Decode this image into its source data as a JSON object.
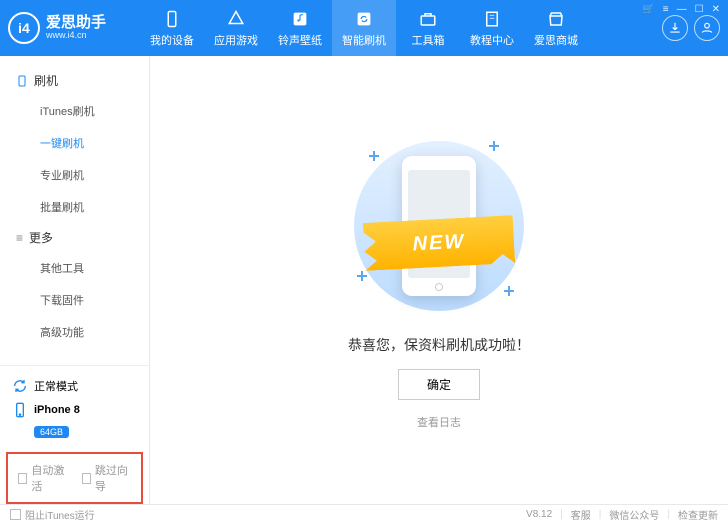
{
  "header": {
    "logo_title": "爱思助手",
    "logo_sub": "www.i4.cn",
    "logo_mark": "i4",
    "tabs": [
      {
        "label": "我的设备",
        "icon": "phone"
      },
      {
        "label": "应用游戏",
        "icon": "apps"
      },
      {
        "label": "铃声壁纸",
        "icon": "music"
      },
      {
        "label": "智能刷机",
        "icon": "refresh",
        "active": true
      },
      {
        "label": "工具箱",
        "icon": "toolbox"
      },
      {
        "label": "教程中心",
        "icon": "book"
      },
      {
        "label": "爱思商城",
        "icon": "shop"
      }
    ],
    "download_btn": "download",
    "user_btn": "user"
  },
  "sidebar": {
    "group1_label": "刷机",
    "group1_items": [
      "iTunes刷机",
      "一键刷机",
      "专业刷机",
      "批量刷机"
    ],
    "group1_active_index": 1,
    "group2_label": "更多",
    "group2_items": [
      "其他工具",
      "下载固件",
      "高级功能"
    ],
    "mode_label": "正常模式",
    "device_label": "iPhone 8",
    "device_storage": "64GB",
    "chk_auto": "自动激活",
    "chk_skip": "跳过向导"
  },
  "main": {
    "ribbon_text": "NEW",
    "success_text": "恭喜您，保资料刷机成功啦！",
    "ok_label": "确定",
    "log_label": "查看日志"
  },
  "footer": {
    "block_itunes": "阻止iTunes运行",
    "version": "V8.12",
    "support": "客服",
    "wechat": "微信公众号",
    "update": "检查更新"
  }
}
